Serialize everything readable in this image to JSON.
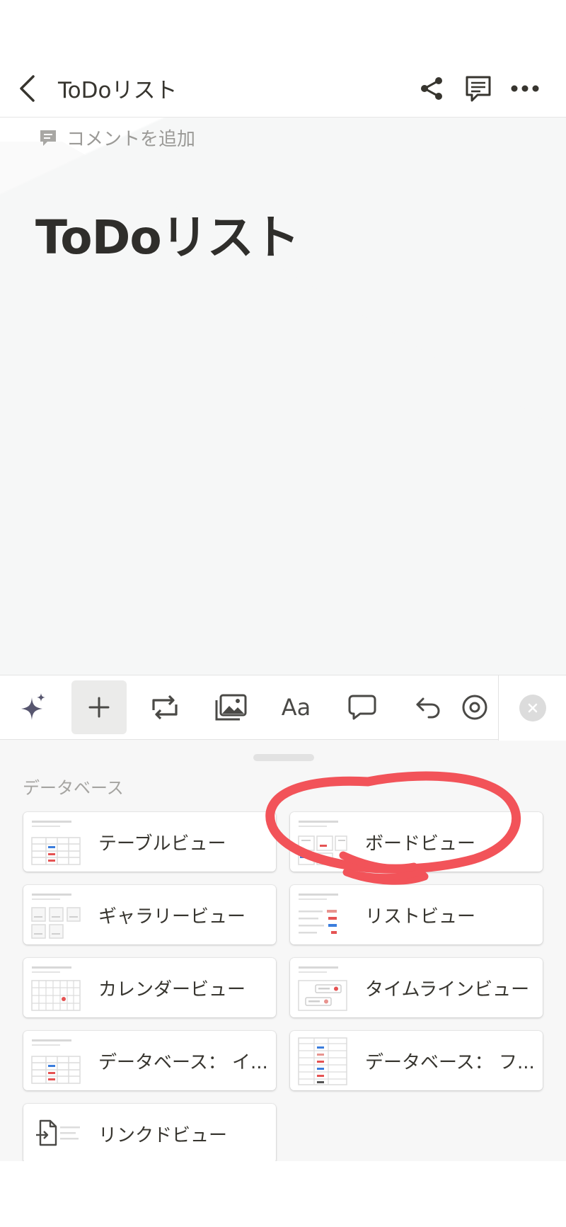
{
  "header": {
    "title": "ToDoリスト"
  },
  "add_comment": {
    "label": "コメントを追加"
  },
  "page": {
    "title": "ToDoリスト"
  },
  "toolbar": {
    "text_style_label": "Aa"
  },
  "sheet": {
    "section_label": "データベース",
    "items": [
      {
        "label": "テーブルビュー",
        "icon": "table-view-icon"
      },
      {
        "label": "ボードビュー",
        "icon": "board-view-icon"
      },
      {
        "label": "ギャラリービュー",
        "icon": "gallery-view-icon"
      },
      {
        "label": "リストビュー",
        "icon": "list-view-icon"
      },
      {
        "label": "カレンダービュー",
        "icon": "calendar-view-icon"
      },
      {
        "label": "タイムラインビュー",
        "icon": "timeline-view-icon"
      },
      {
        "label": "データベース： イ...",
        "icon": "inline-database-icon"
      },
      {
        "label": "データベース： フ...",
        "icon": "fullpage-database-icon"
      },
      {
        "label": "リンクドビュー",
        "icon": "linked-view-icon"
      }
    ]
  },
  "colors": {
    "accent_red": "#e55353",
    "accent_blue": "#3b7ddd",
    "highlight": "#f25359"
  }
}
